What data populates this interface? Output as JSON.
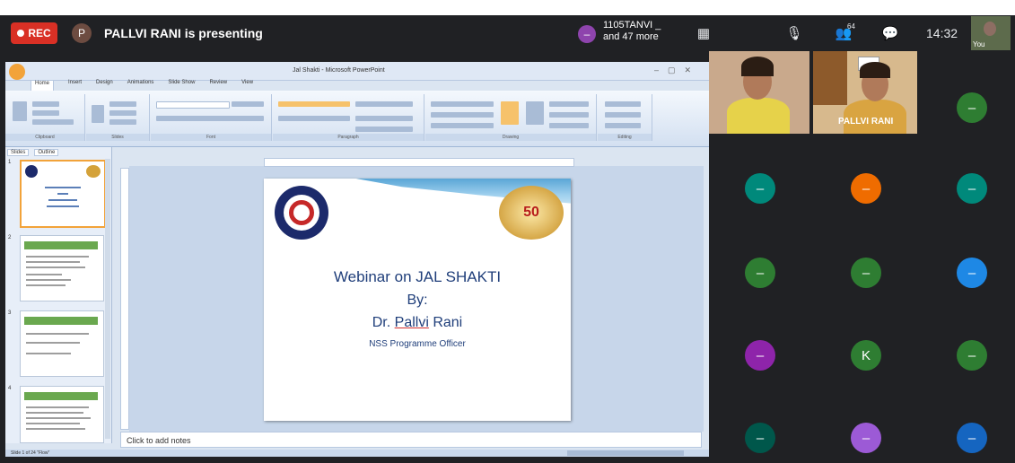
{
  "meet": {
    "rec_label": "REC",
    "presenter_initial": "P",
    "presenting_text": "PALLVI RANI is presenting",
    "others_initial": "–",
    "others_name": "1105TANVI _",
    "others_more": "and 47 more",
    "participant_count": "64",
    "time": "14:32",
    "you_label": "You",
    "colors": {
      "rec": "#d93025",
      "bar": "#202124"
    }
  },
  "ppt": {
    "window_title": "Jal Shakti - Microsoft PowerPoint",
    "ribbon_tabs": [
      "Home",
      "Insert",
      "Design",
      "Animations",
      "Slide Show",
      "Review",
      "View"
    ],
    "ribbon_groups": [
      "Clipboard",
      "Slides",
      "Font",
      "Paragraph",
      "Drawing",
      "Editing"
    ],
    "panel_tabs": [
      "Slides",
      "Outline"
    ],
    "thumb_numbers": [
      "1",
      "2",
      "3",
      "4"
    ],
    "slide": {
      "line1": "Webinar on JAL SHAKTI",
      "line2": "By:",
      "line3_prefix": "Dr. ",
      "line3_name": "Pallvi",
      "line3_suffix": " Rani",
      "line4": "NSS Programme Officer",
      "badge_text": "50"
    },
    "notes_placeholder": "Click to add notes",
    "status_text": "Slide 1 of 24   \"Flow\""
  },
  "participants": [
    {
      "type": "camera",
      "label": ""
    },
    {
      "type": "camera",
      "label": "PALLVI RANI"
    },
    {
      "type": "avatar",
      "initial": "–",
      "color": "#2e7d32"
    },
    {
      "type": "avatar",
      "initial": "–",
      "color": "#00897b"
    },
    {
      "type": "avatar",
      "initial": "–",
      "color": "#ef6c00"
    },
    {
      "type": "avatar",
      "initial": "–",
      "color": "#00897b"
    },
    {
      "type": "avatar",
      "initial": "–",
      "color": "#2e7d32"
    },
    {
      "type": "avatar",
      "initial": "–",
      "color": "#2e7d32"
    },
    {
      "type": "avatar",
      "initial": "–",
      "color": "#1e88e5"
    },
    {
      "type": "avatar",
      "initial": "–",
      "color": "#8e24aa"
    },
    {
      "type": "avatar",
      "initial": "K",
      "color": "#2e7d32"
    },
    {
      "type": "avatar",
      "initial": "–",
      "color": "#2e7d32"
    },
    {
      "type": "avatar",
      "initial": "–",
      "color": "#00574b"
    },
    {
      "type": "avatar",
      "initial": "–",
      "color": "#9c5ad6"
    },
    {
      "type": "avatar",
      "initial": "–",
      "color": "#1565c0"
    }
  ]
}
